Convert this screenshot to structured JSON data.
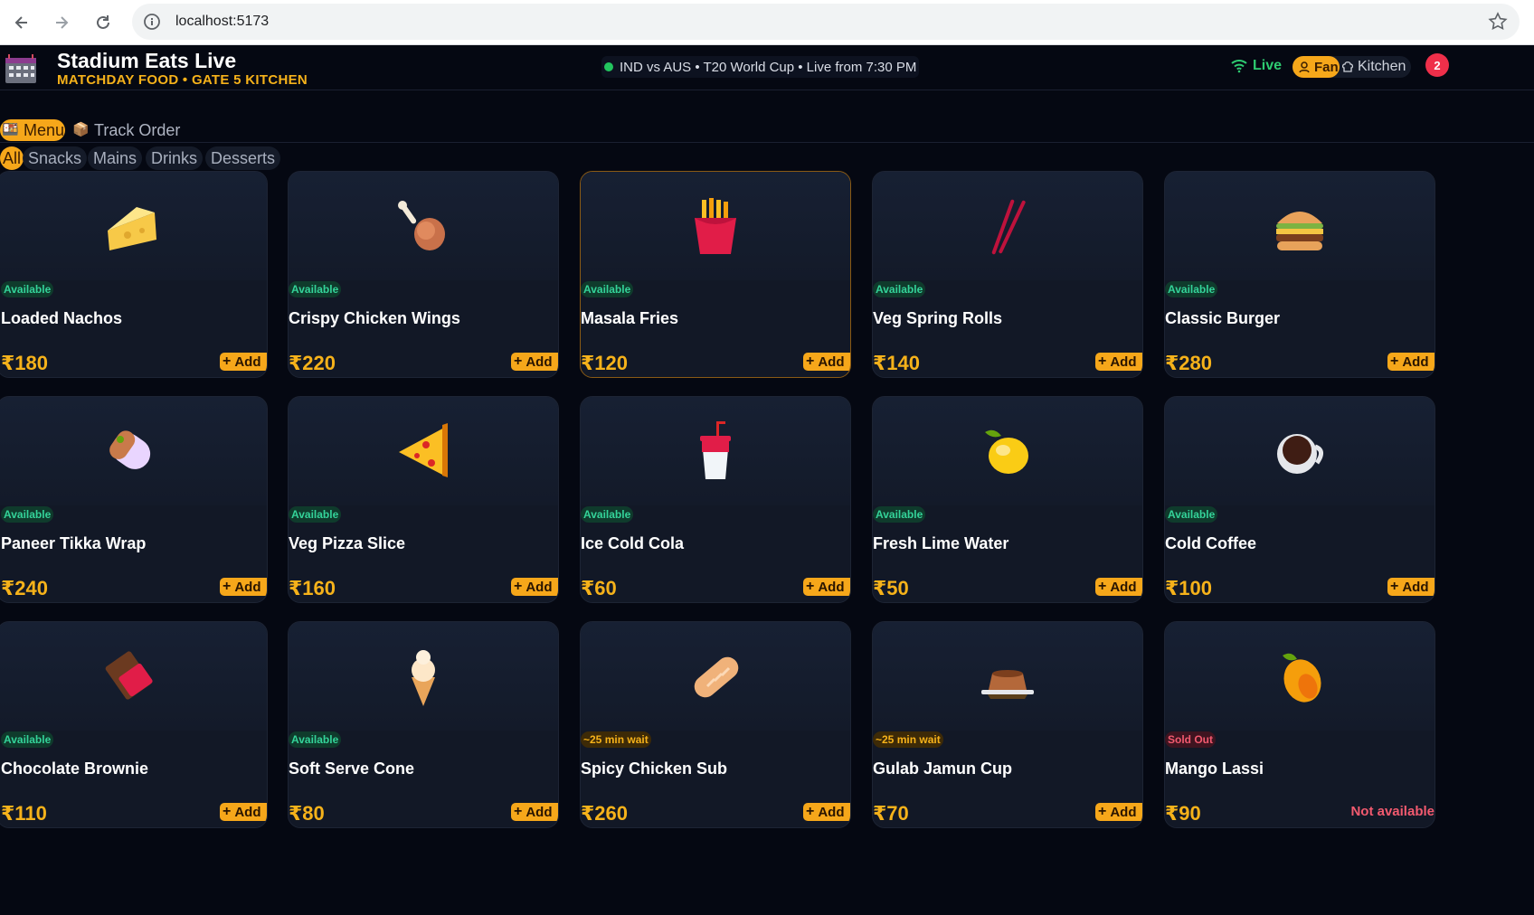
{
  "browser": {
    "url": "localhost:5173"
  },
  "header": {
    "title": "Stadium Eats Live",
    "subtitle": "MATCHDAY FOOD • GATE 5 KITCHEN",
    "match": "IND vs AUS • T20 World Cup • Live from 7:30 PM",
    "live_label": "Live",
    "role_fan": "Fan",
    "role_kitchen": "Kitchen",
    "notification_count": "2"
  },
  "tabs": {
    "menu": "Menu",
    "track": "Track Order"
  },
  "categories": [
    "All",
    "Snacks",
    "Mains",
    "Drinks",
    "Desserts"
  ],
  "add_label": "Add",
  "items": [
    {
      "name": "Loaded Nachos",
      "price": "₹180",
      "status": "Available",
      "icon": "cheese-icon"
    },
    {
      "name": "Crispy Chicken Wings",
      "price": "₹220",
      "status": "Available",
      "icon": "chicken-leg-icon"
    },
    {
      "name": "Masala Fries",
      "price": "₹120",
      "status": "Available",
      "icon": "fries-icon"
    },
    {
      "name": "Veg Spring Rolls",
      "price": "₹140",
      "status": "Available",
      "icon": "chopsticks-icon"
    },
    {
      "name": "Classic Burger",
      "price": "₹280",
      "status": "Available",
      "icon": "burger-icon"
    },
    {
      "name": "Paneer Tikka Wrap",
      "price": "₹240",
      "status": "Available",
      "icon": "burrito-icon"
    },
    {
      "name": "Veg Pizza Slice",
      "price": "₹160",
      "status": "Available",
      "icon": "pizza-icon"
    },
    {
      "name": "Ice Cold Cola",
      "price": "₹60",
      "status": "Available",
      "icon": "cup-straw-icon"
    },
    {
      "name": "Fresh Lime Water",
      "price": "₹50",
      "status": "Available",
      "icon": "lemon-icon"
    },
    {
      "name": "Cold Coffee",
      "price": "₹100",
      "status": "Available",
      "icon": "coffee-icon"
    },
    {
      "name": "Chocolate Brownie",
      "price": "₹110",
      "status": "Available",
      "icon": "chocolate-icon"
    },
    {
      "name": "Soft Serve Cone",
      "price": "₹80",
      "status": "Available",
      "icon": "ice-cream-icon"
    },
    {
      "name": "Spicy Chicken Sub",
      "price": "₹260",
      "status": "~25 min wait",
      "icon": "bread-icon"
    },
    {
      "name": "Gulab Jamun Cup",
      "price": "₹70",
      "status": "~25 min wait",
      "icon": "pudding-icon"
    },
    {
      "name": "Mango Lassi",
      "price": "₹90",
      "status": "Sold Out",
      "icon": "mango-icon",
      "unavailable": "Not available"
    }
  ],
  "colors": {
    "accent": "#f6a71a",
    "available": "#34d399",
    "sold_out": "#f25a6f",
    "background": "#050812",
    "card": "#121826"
  }
}
